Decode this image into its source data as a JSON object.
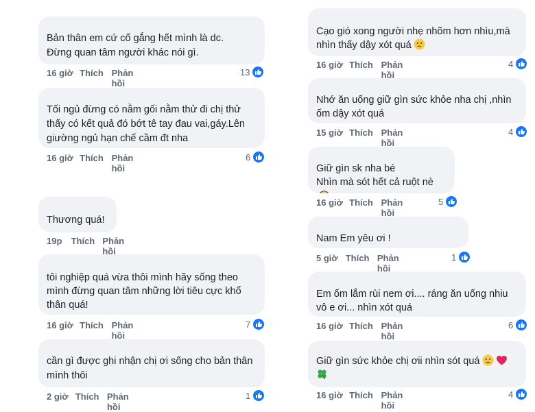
{
  "left": [
    {
      "text": "Bản thân em cứ cố gắng hết mình là dc.\nĐừng quan tâm người khác nói gì.",
      "time": "16 giờ",
      "like": "Thích",
      "reply": "Phản hồi",
      "count": "13"
    },
    {
      "text": "Tối ngủ đừng có nằm gối nằm thử đi chị thử thấy có kết quả đó bớt tê tay đau vai,gáy.Lên giường ngủ hạn chế cầm đt nha",
      "time": "16 giờ",
      "like": "Thích",
      "reply": "Phản hồi",
      "count": "6"
    },
    {
      "text": "Thương quá!",
      "time": "19p",
      "like": "Thích",
      "reply": "Phản hồi",
      "count": ""
    },
    {
      "text": "tôi nghiệp quá  vừa thôi mình hãy sống theo mình đừng quan tâm những lời tiêu cực khổ thân quá!",
      "time": "16 giờ",
      "like": "Thích",
      "reply": "Phản hồi",
      "count": "7"
    },
    {
      "text": "cần gì được ghi nhận chị ơi sống cho bản thân mình thôi",
      "time": "2 giờ",
      "like": "Thích",
      "reply": "Phản hồi",
      "count": "1"
    }
  ],
  "right": [
    {
      "text": "Cạo gió xong người nhẹ nhõm hơn nhìu,mà nhìn thấy dậy xót quá",
      "time": "16 giờ",
      "like": "Thích",
      "reply": "Phản hồi",
      "count": "4"
    },
    {
      "text": "Nhớ ăn uống giữ gìn sức khỏe nha chị ,nhìn ốm dậy xót quá",
      "time": "15 giờ",
      "like": "Thích",
      "reply": "Phản hồi",
      "count": "4"
    },
    {
      "text": "Giữ gìn sk nha bé\nNhìn mà sót hết cả ruột nè",
      "time": "16 giờ",
      "like": "Thích",
      "reply": "Phản hồi",
      "count": "5"
    },
    {
      "text": "Nam Em yêu ơi !",
      "time": "5 giờ",
      "like": "Thích",
      "reply": "Phản hồi",
      "count": "1"
    },
    {
      "text": "Em ốm lắm rùi nem ơi.... ráng ăn uống nhiu vô e ơi... nhìn xót quá",
      "time": "16 giờ",
      "like": "Thích",
      "reply": "Phản hồi",
      "count": "6"
    },
    {
      "text": "Giữ gìn sức khỏe chị ơii nhìn sót quá",
      "time": "16 giờ",
      "like": "Thích",
      "reply": "Phản hồi",
      "count": "4"
    }
  ],
  "icons": {
    "like_reaction": "like-icon",
    "sad_emoji": "crying-face-icon",
    "heart_emoji": "red-heart-icon",
    "clover_emoji": "four-leaf-clover-icon",
    "facepalm_emoji": "facepalm-icon"
  },
  "colors": {
    "bubble": "#f0f2f5",
    "meta": "#606770",
    "like_blue": "#1877f2"
  }
}
